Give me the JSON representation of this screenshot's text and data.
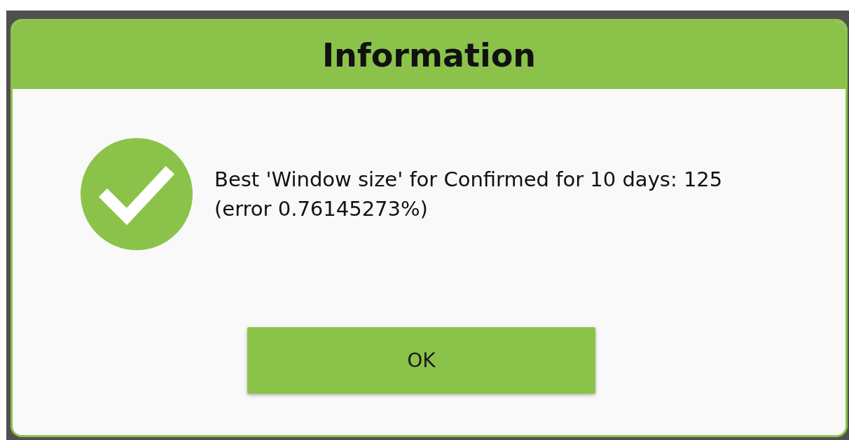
{
  "dialog": {
    "title": "Information",
    "message_lines": [
      "Best 'Window size' for Confirmed for 10 days: 125",
      "(error 0.76145273%)"
    ],
    "buttons": [
      "OK"
    ]
  }
}
